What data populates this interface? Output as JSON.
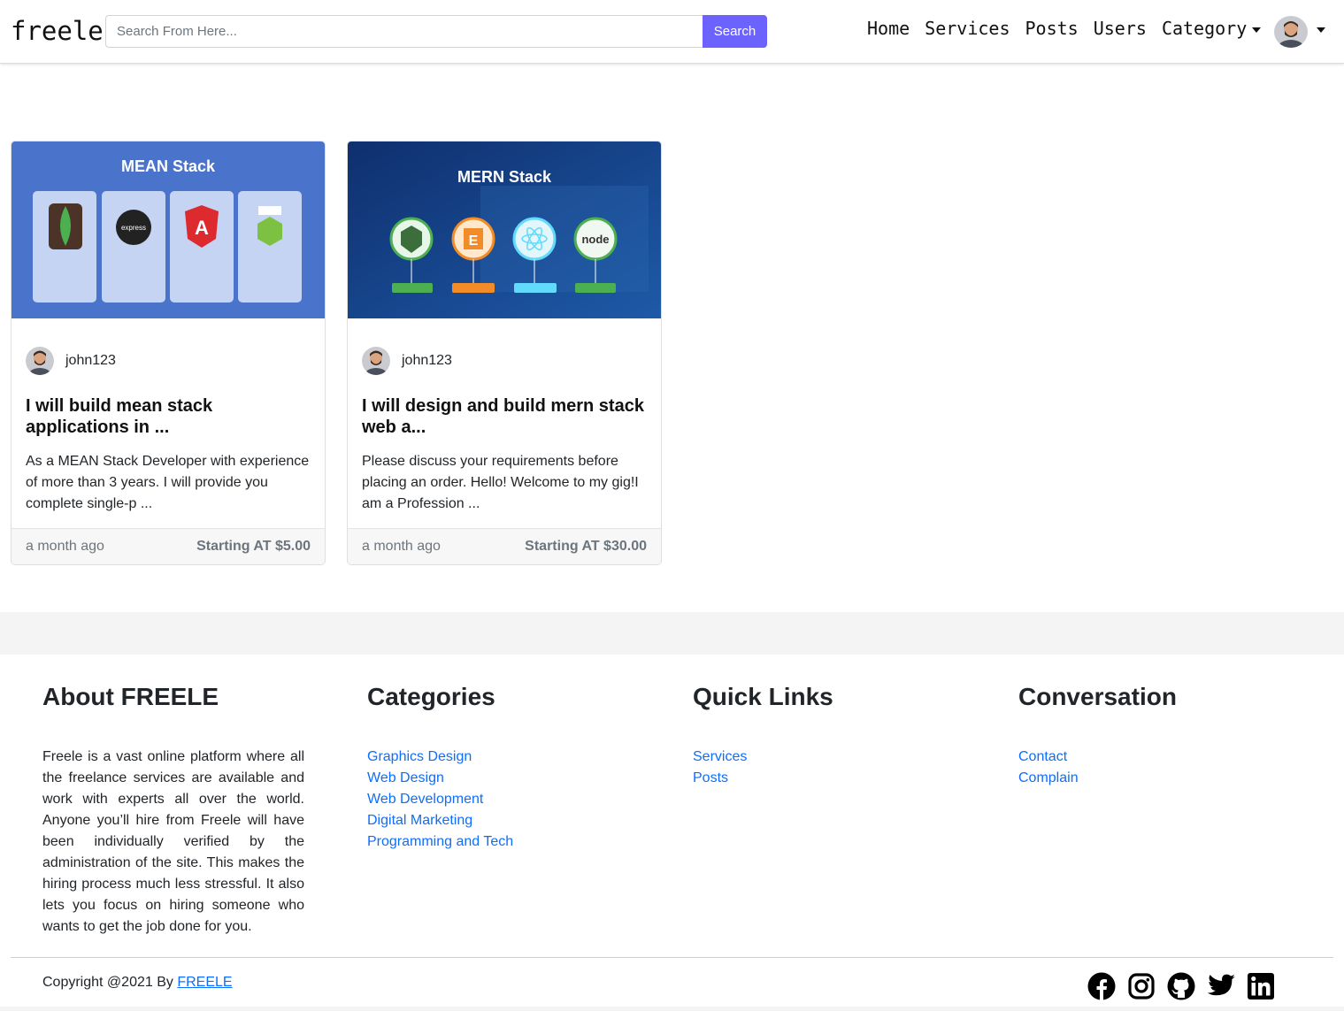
{
  "navbar": {
    "brand": "freele",
    "search_placeholder": "Search From Here...",
    "search_button": "Search",
    "links": {
      "home": "Home",
      "services": "Services",
      "posts": "Posts",
      "users": "Users",
      "category": "Category"
    }
  },
  "cards": [
    {
      "image_title": "MEAN Stack",
      "author": "john123",
      "title": "I will build mean stack applications in ...",
      "text": "As a MEAN Stack Developer with experience of more than 3 years. I will provide you complete single-p ...",
      "time": "a month ago",
      "price": "Starting AT $5.00"
    },
    {
      "image_title": "MERN Stack",
      "author": "john123",
      "title": "I will design and build mern stack web a...",
      "text": "Please discuss your requirements before placing an order. Hello! Welcome to my gig!I am a Profession ...",
      "time": "a month ago",
      "price": "Starting AT $30.00"
    }
  ],
  "footer": {
    "about": {
      "heading": "About FREELE",
      "text": "Freele is a vast online platform where all the freelance services are available and work with experts all over the world. Anyone you’ll hire from Freele will have been individually verified by the administration of the site. This makes the hiring process much less stressful. It also lets you focus on hiring someone who wants to get the job done for you."
    },
    "categories": {
      "heading": "Categories",
      "items": [
        "Graphics Design",
        "Web Design",
        "Web Development",
        "Digital Marketing",
        "Programming and Tech"
      ]
    },
    "quick_links": {
      "heading": "Quick Links",
      "items": [
        "Services",
        "Posts"
      ]
    },
    "conversation": {
      "heading": "Conversation",
      "items": [
        "Contact",
        "Complain"
      ]
    },
    "copyright_prefix": "Copyright @2021 By ",
    "copyright_link": "FREELE",
    "socials": [
      "facebook-icon",
      "instagram-icon",
      "github-icon",
      "twitter-icon",
      "linkedin-icon"
    ]
  },
  "colors": {
    "accent": "#6c63ff",
    "link": "#0d6efd"
  }
}
